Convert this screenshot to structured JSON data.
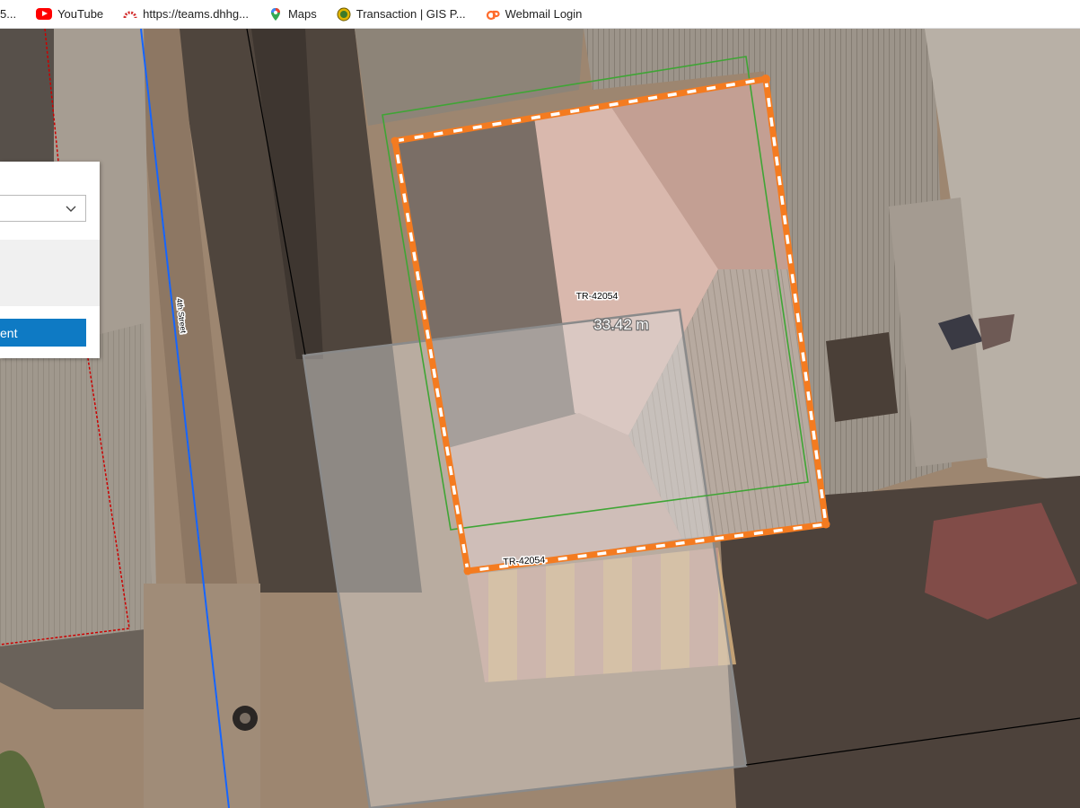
{
  "bookmarks": [
    {
      "label": "5...",
      "icon": "bookmark-icon"
    },
    {
      "label": "YouTube",
      "icon": "youtube-icon"
    },
    {
      "label": "https://teams.dhhg...",
      "icon": "teams-link-icon"
    },
    {
      "label": "Maps",
      "icon": "maps-pin-icon"
    },
    {
      "label": "Transaction | GIS P...",
      "icon": "gis-portal-icon"
    },
    {
      "label": "Webmail Login",
      "icon": "cpanel-icon"
    }
  ],
  "map": {
    "parcel_label_top": "TR-42054",
    "parcel_label_bottom": "TR-42054",
    "measurement": "33.42 m",
    "street_label": "4th Street"
  },
  "panel": {
    "select_value": "",
    "button_label": "ent"
  },
  "colors": {
    "sketch_orange": "#f47b20",
    "parcel_green": "#3fa535",
    "street_blue": "#1565ff",
    "boundary_red": "#cc0000",
    "button_blue": "#0e7ac4"
  }
}
